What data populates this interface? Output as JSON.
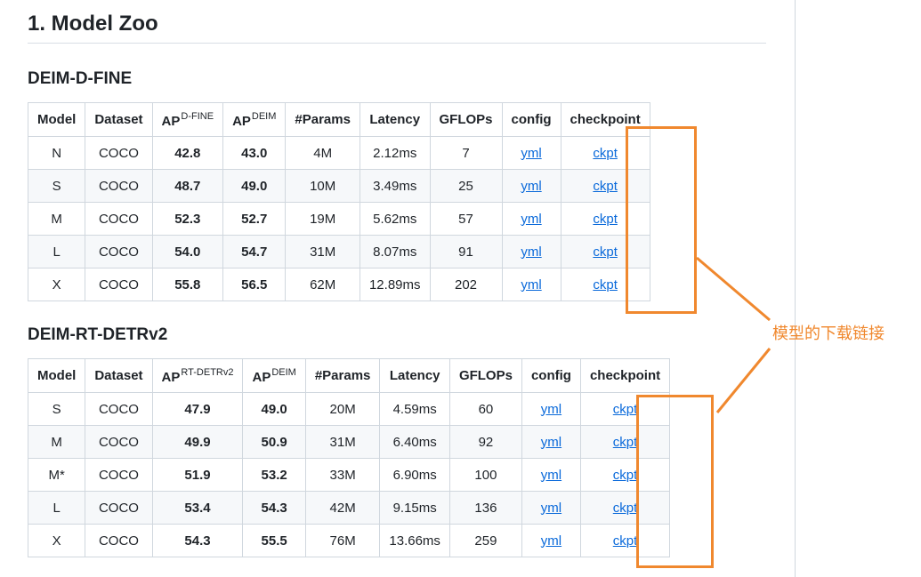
{
  "title": "1. Model Zoo",
  "annotation": {
    "text": "模型的下载链接",
    "color": "#f0882e"
  },
  "tables": [
    {
      "heading": "DEIM-D-FINE",
      "headers": {
        "model": "Model",
        "dataset": "Dataset",
        "ap1": "AP",
        "ap1_sup": "D-FINE",
        "ap2": "AP",
        "ap2_sup": "DEIM",
        "params": "#Params",
        "latency": "Latency",
        "gflops": "GFLOPs",
        "config": "config",
        "checkpoint": "checkpoint"
      },
      "rows": [
        {
          "model": "N",
          "dataset": "COCO",
          "ap1": "42.8",
          "ap2": "43.0",
          "params": "4M",
          "latency": "2.12ms",
          "gflops": "7",
          "config": "yml",
          "checkpoint": "ckpt"
        },
        {
          "model": "S",
          "dataset": "COCO",
          "ap1": "48.7",
          "ap2": "49.0",
          "params": "10M",
          "latency": "3.49ms",
          "gflops": "25",
          "config": "yml",
          "checkpoint": "ckpt"
        },
        {
          "model": "M",
          "dataset": "COCO",
          "ap1": "52.3",
          "ap2": "52.7",
          "params": "19M",
          "latency": "5.62ms",
          "gflops": "57",
          "config": "yml",
          "checkpoint": "ckpt"
        },
        {
          "model": "L",
          "dataset": "COCO",
          "ap1": "54.0",
          "ap2": "54.7",
          "params": "31M",
          "latency": "8.07ms",
          "gflops": "91",
          "config": "yml",
          "checkpoint": "ckpt"
        },
        {
          "model": "X",
          "dataset": "COCO",
          "ap1": "55.8",
          "ap2": "56.5",
          "params": "62M",
          "latency": "12.89ms",
          "gflops": "202",
          "config": "yml",
          "checkpoint": "ckpt"
        }
      ]
    },
    {
      "heading": "DEIM-RT-DETRv2",
      "headers": {
        "model": "Model",
        "dataset": "Dataset",
        "ap1": "AP",
        "ap1_sup": "RT-DETRv2",
        "ap2": "AP",
        "ap2_sup": "DEIM",
        "params": "#Params",
        "latency": "Latency",
        "gflops": "GFLOPs",
        "config": "config",
        "checkpoint": "checkpoint"
      },
      "rows": [
        {
          "model": "S",
          "dataset": "COCO",
          "ap1": "47.9",
          "ap2": "49.0",
          "params": "20M",
          "latency": "4.59ms",
          "gflops": "60",
          "config": "yml",
          "checkpoint": "ckpt"
        },
        {
          "model": "M",
          "dataset": "COCO",
          "ap1": "49.9",
          "ap2": "50.9",
          "params": "31M",
          "latency": "6.40ms",
          "gflops": "92",
          "config": "yml",
          "checkpoint": "ckpt"
        },
        {
          "model": "M*",
          "dataset": "COCO",
          "ap1": "51.9",
          "ap2": "53.2",
          "params": "33M",
          "latency": "6.90ms",
          "gflops": "100",
          "config": "yml",
          "checkpoint": "ckpt"
        },
        {
          "model": "L",
          "dataset": "COCO",
          "ap1": "53.4",
          "ap2": "54.3",
          "params": "42M",
          "latency": "9.15ms",
          "gflops": "136",
          "config": "yml",
          "checkpoint": "ckpt"
        },
        {
          "model": "X",
          "dataset": "COCO",
          "ap1": "54.3",
          "ap2": "55.5",
          "params": "76M",
          "latency": "13.66ms",
          "gflops": "259",
          "config": "yml",
          "checkpoint": "ckpt"
        }
      ]
    }
  ]
}
